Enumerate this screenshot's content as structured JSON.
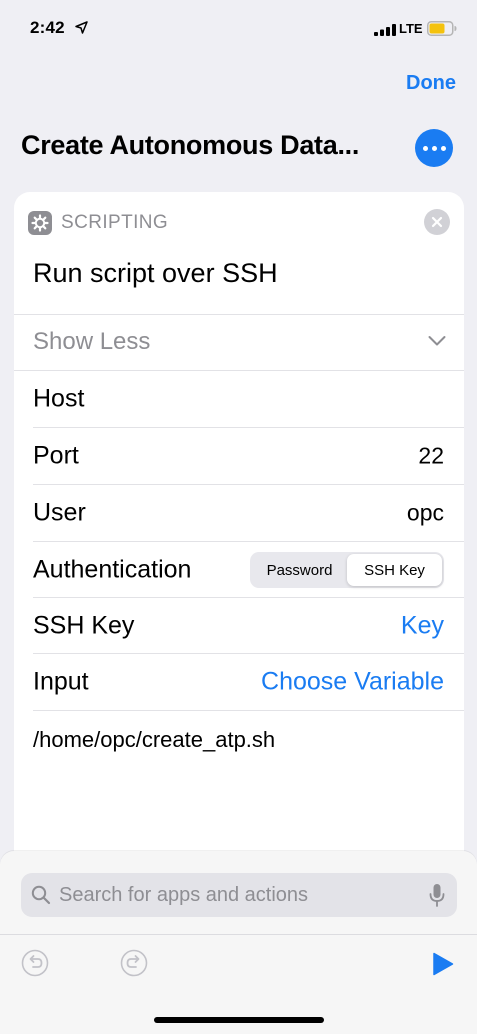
{
  "status_bar": {
    "time": "2:42",
    "network": "LTE"
  },
  "nav": {
    "done_label": "Done",
    "title": "Create Autonomous Data..."
  },
  "card": {
    "category": "SCRIPTING",
    "action_title": "Run script over SSH",
    "show_less_label": "Show Less",
    "params": [
      {
        "label": "Host",
        "value": ""
      },
      {
        "label": "Port",
        "value": "22"
      },
      {
        "label": "User",
        "value": "opc"
      },
      {
        "label": "Authentication",
        "options": [
          "Password",
          "SSH Key"
        ],
        "selected": "SSH Key"
      },
      {
        "label": "SSH Key",
        "value": "Key"
      },
      {
        "label": "Input",
        "value": "Choose Variable"
      }
    ],
    "script": "/home/opc/create_atp.sh"
  },
  "search": {
    "placeholder": "Search for apps and actions"
  },
  "colors": {
    "accent": "#1a7cf2",
    "background": "#efeff4",
    "secondary_text": "#8e8e93"
  }
}
